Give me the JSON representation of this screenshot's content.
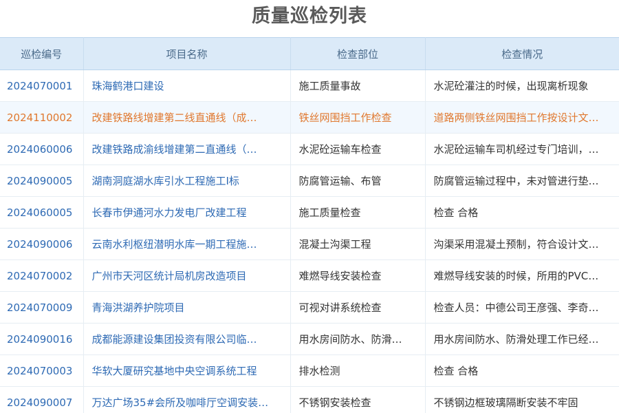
{
  "page": {
    "title": "质量巡检列表"
  },
  "table": {
    "headers": [
      "巡检编号",
      "项目名称",
      "检查部位",
      "检查情况"
    ],
    "rows": [
      {
        "code": "2024070001",
        "project": "珠海鹤港口建设",
        "part": "施工质量事故",
        "status": "水泥砼灌注的时候，出现离析现象"
      },
      {
        "code": "2024110002",
        "project": "改建铁路线增建第二线直通线（成…",
        "part": "铁丝网围挡工作检查",
        "status": "道路两侧铁丝网围挡工作按设计文…"
      },
      {
        "code": "2024060006",
        "project": "改建铁路成渝线增建第二直通线（…",
        "part": "水泥砼运输车检查",
        "status": "水泥砼运输车司机经过专门培训，…"
      },
      {
        "code": "2024090005",
        "project": "湖南洞庭湖水库引水工程施工I标",
        "part": "防腐管运输、布管",
        "status": "防腐管运输过程中，未对管进行垫…"
      },
      {
        "code": "2024060005",
        "project": "长春市伊通河水力发电厂改建工程",
        "part": "施工质量检查",
        "status": "检查 合格"
      },
      {
        "code": "2024090006",
        "project": "云南水利枢纽潜明水库一期工程施…",
        "part": "混凝土沟渠工程",
        "status": "沟渠采用混凝土预制，符合设计文…"
      },
      {
        "code": "2024070002",
        "project": "广州市天河区统计局机房改造项目",
        "part": "难燃导线安装检查",
        "status": "难燃导线安装的时候，所用的PVC…"
      },
      {
        "code": "2024070009",
        "project": "青海洪湖养护院项目",
        "part": "可视对讲系统检查",
        "status": "检查人员：中德公司王彦强、李奇…"
      },
      {
        "code": "2024090016",
        "project": "成都能源建设集团投资有限公司临…",
        "part": "用水房间防水、防滑…",
        "status": "用水房间防水、防滑处理工作已经…"
      },
      {
        "code": "2024070003",
        "project": "华软大厦研究基地中央空调系统工程",
        "part": "排水检测",
        "status": "检查 合格"
      },
      {
        "code": "2024090007",
        "project": "万达广场35#会所及咖啡厅空调安装…",
        "part": "不锈钢安装检查",
        "status": "不锈钢边框玻璃隔断安装不牢固"
      }
    ]
  },
  "colors": {
    "link_blue": "#2e6ab4",
    "highlight_orange": "#e0782e",
    "header_bg": "#dbeaf8"
  }
}
